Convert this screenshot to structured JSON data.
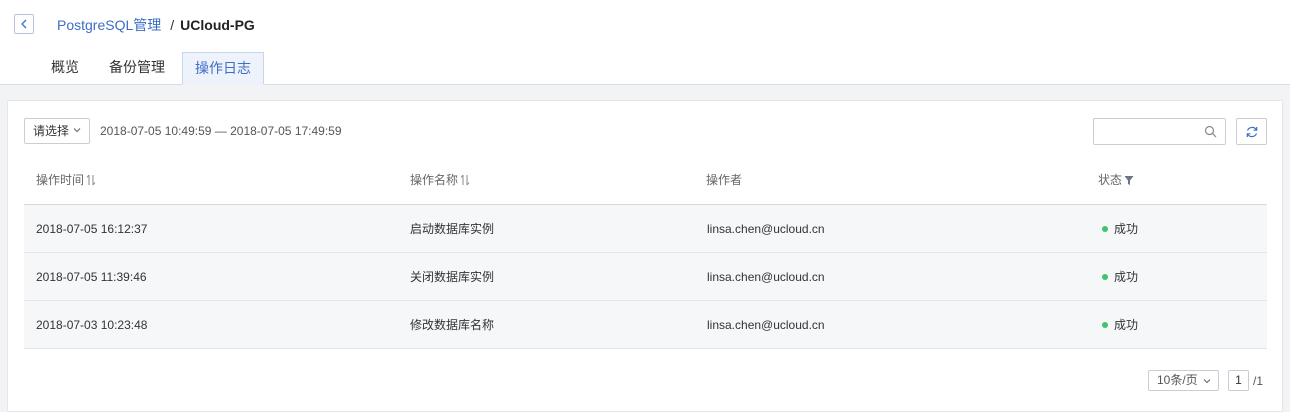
{
  "breadcrumb": {
    "parent": "PostgreSQL管理",
    "separator": "/",
    "current": "UCloud-PG"
  },
  "tabs": [
    {
      "label": "概览"
    },
    {
      "label": "备份管理"
    },
    {
      "label": "操作日志",
      "active": true
    }
  ],
  "filter": {
    "select_label": "请选择",
    "date_range": "2018-07-05 10:49:59 — 2018-07-05 17:49:59",
    "search_placeholder": ""
  },
  "table": {
    "columns": [
      "操作时间",
      "操作名称",
      "操作者",
      "状态"
    ],
    "rows": [
      {
        "time": "2018-07-05 16:12:37",
        "name": "启动数据库实例",
        "operator": "linsa.chen@ucloud.cn",
        "status": "成功"
      },
      {
        "time": "2018-07-05 11:39:46",
        "name": "关闭数据库实例",
        "operator": "linsa.chen@ucloud.cn",
        "status": "成功"
      },
      {
        "time": "2018-07-03 10:23:48",
        "name": "修改数据库名称",
        "operator": "linsa.chen@ucloud.cn",
        "status": "成功"
      }
    ]
  },
  "pagination": {
    "page_size": "10条/页",
    "current_page": "1",
    "total": "/1"
  },
  "colors": {
    "accent": "#3c6ec4",
    "success": "#3ec46d",
    "background": "#f2f3f5"
  },
  "icons": [
    "back-arrow-icon",
    "chevron-down-icon",
    "search-icon",
    "refresh-icon",
    "sort-icon",
    "filter-icon"
  ]
}
